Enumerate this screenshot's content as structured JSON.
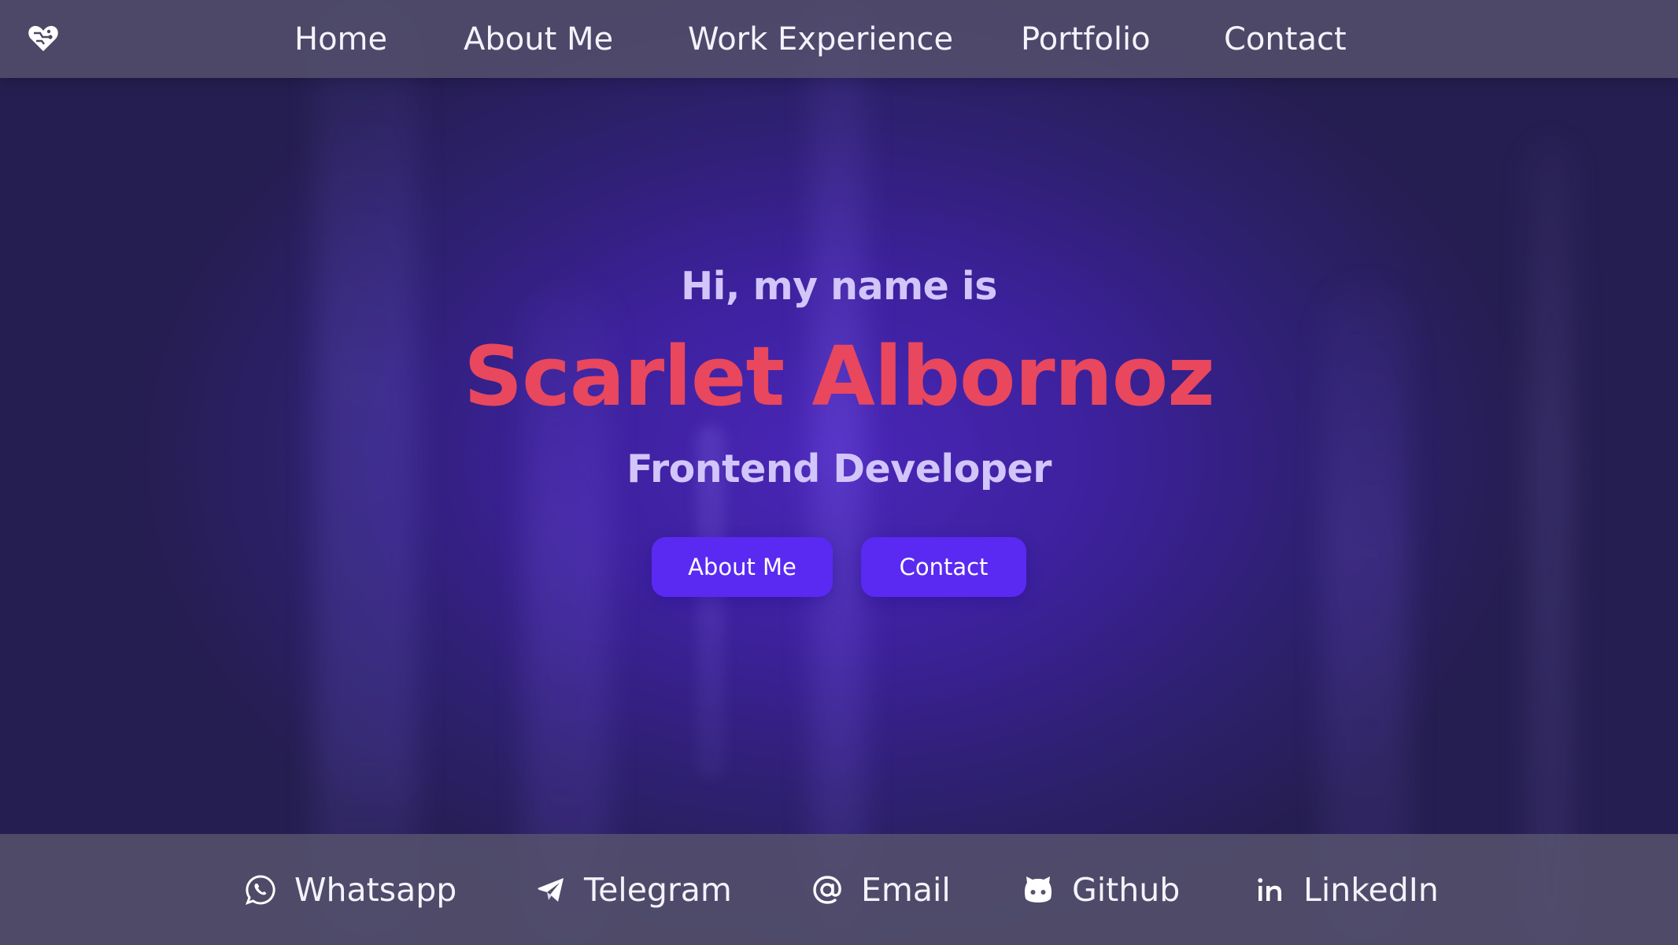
{
  "nav": {
    "logo_icon": "heart-circuit-icon",
    "items": [
      {
        "label": "Home"
      },
      {
        "label": "About Me"
      },
      {
        "label": "Work Experience"
      },
      {
        "label": "Portfolio"
      },
      {
        "label": "Contact"
      }
    ]
  },
  "hero": {
    "greeting": "Hi, my name is",
    "name": "Scarlet Albornoz",
    "role": "Frontend Developer",
    "buttons": [
      {
        "label": "About Me"
      },
      {
        "label": "Contact"
      }
    ],
    "name_color": "#e8475d",
    "accent_color": "#5a2af2"
  },
  "footer": {
    "links": [
      {
        "label": "Whatsapp",
        "icon": "whatsapp-icon"
      },
      {
        "label": "Telegram",
        "icon": "telegram-icon"
      },
      {
        "label": "Email",
        "icon": "at-sign-icon"
      },
      {
        "label": "Github",
        "icon": "github-icon"
      },
      {
        "label": "LinkedIn",
        "icon": "linkedin-icon"
      }
    ]
  }
}
